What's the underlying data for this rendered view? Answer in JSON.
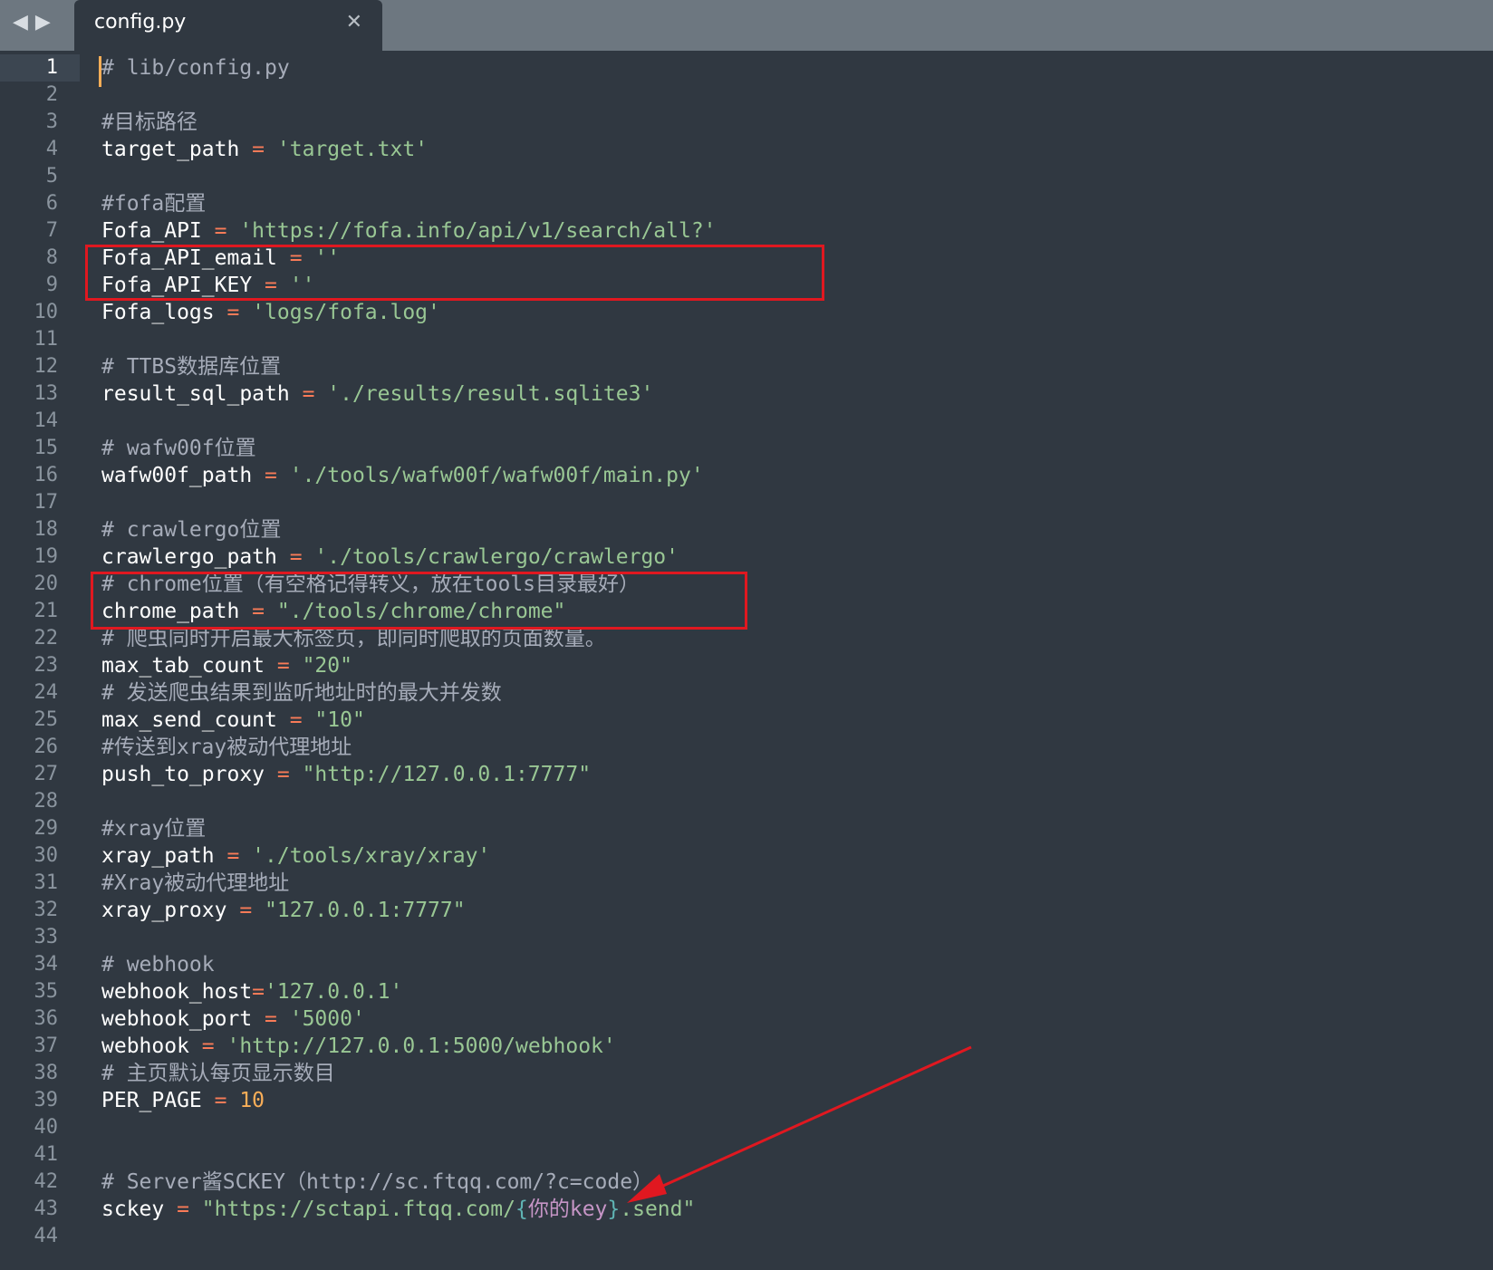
{
  "tab": {
    "title": "config.py"
  },
  "colors": {
    "background": "#303841",
    "tab_bar": "#6d7780",
    "highlight": "#e01820",
    "string": "#99c794",
    "operator": "#f97b58",
    "number": "#f9ae58",
    "comment": "#a6acb9"
  },
  "icons": {
    "back": "triangle-left-icon",
    "forward": "triangle-right-icon",
    "close": "close-icon"
  },
  "lines": [
    {
      "n": "1",
      "t": [
        [
          "cmt",
          "# lib/config.py"
        ]
      ]
    },
    {
      "n": "2",
      "t": []
    },
    {
      "n": "3",
      "t": [
        [
          "cmt",
          "#目标路径"
        ]
      ]
    },
    {
      "n": "4",
      "t": [
        [
          "var",
          "target_path"
        ],
        [
          "op",
          " = "
        ],
        [
          "str",
          "'target.txt'"
        ]
      ]
    },
    {
      "n": "5",
      "t": []
    },
    {
      "n": "6",
      "t": [
        [
          "cmt",
          "#fofa配置"
        ]
      ]
    },
    {
      "n": "7",
      "t": [
        [
          "var",
          "Fofa_API"
        ],
        [
          "op",
          " = "
        ],
        [
          "str",
          "'https://fofa.info/api/v1/search/all?'"
        ]
      ]
    },
    {
      "n": "8",
      "t": [
        [
          "var",
          "Fofa_API_email"
        ],
        [
          "op",
          " = "
        ],
        [
          "str",
          "''"
        ]
      ]
    },
    {
      "n": "9",
      "t": [
        [
          "var",
          "Fofa_API_KEY"
        ],
        [
          "op",
          " = "
        ],
        [
          "str",
          "''"
        ]
      ]
    },
    {
      "n": "10",
      "t": [
        [
          "var",
          "Fofa_logs"
        ],
        [
          "op",
          " = "
        ],
        [
          "str",
          "'logs/fofa.log'"
        ]
      ]
    },
    {
      "n": "11",
      "t": []
    },
    {
      "n": "12",
      "t": [
        [
          "cmt",
          "# TTBS数据库位置"
        ]
      ]
    },
    {
      "n": "13",
      "t": [
        [
          "var",
          "result_sql_path"
        ],
        [
          "op",
          " = "
        ],
        [
          "str",
          "'./results/result.sqlite3'"
        ]
      ]
    },
    {
      "n": "14",
      "t": []
    },
    {
      "n": "15",
      "t": [
        [
          "cmt",
          "# wafw00f位置"
        ]
      ]
    },
    {
      "n": "16",
      "t": [
        [
          "var",
          "wafw00f_path"
        ],
        [
          "op",
          " = "
        ],
        [
          "str",
          "'./tools/wafw00f/wafw00f/main.py'"
        ]
      ]
    },
    {
      "n": "17",
      "t": []
    },
    {
      "n": "18",
      "t": [
        [
          "cmt",
          "# crawlergo位置"
        ]
      ]
    },
    {
      "n": "19",
      "t": [
        [
          "var",
          "crawlergo_path"
        ],
        [
          "op",
          " = "
        ],
        [
          "str",
          "'./tools/crawlergo/crawlergo'"
        ]
      ]
    },
    {
      "n": "20",
      "t": [
        [
          "cmt",
          "# chrome位置（有空格记得转义，放在tools目录最好）"
        ]
      ]
    },
    {
      "n": "21",
      "t": [
        [
          "var",
          "chrome_path"
        ],
        [
          "op",
          " = "
        ],
        [
          "str",
          "\"./tools/chrome/chrome\""
        ]
      ]
    },
    {
      "n": "22",
      "t": [
        [
          "cmt",
          "# 爬虫同时开启最大标签页，即同时爬取的页面数量。"
        ]
      ]
    },
    {
      "n": "23",
      "t": [
        [
          "var",
          "max_tab_count"
        ],
        [
          "op",
          " = "
        ],
        [
          "str",
          "\"20\""
        ]
      ]
    },
    {
      "n": "24",
      "t": [
        [
          "cmt",
          "# 发送爬虫结果到监听地址时的最大并发数"
        ]
      ]
    },
    {
      "n": "25",
      "t": [
        [
          "var",
          "max_send_count"
        ],
        [
          "op",
          " = "
        ],
        [
          "str",
          "\"10\""
        ]
      ]
    },
    {
      "n": "26",
      "t": [
        [
          "cmt",
          "#传送到xray被动代理地址"
        ]
      ]
    },
    {
      "n": "27",
      "t": [
        [
          "var",
          "push_to_proxy"
        ],
        [
          "op",
          " = "
        ],
        [
          "str",
          "\"http://127.0.0.1:7777\""
        ]
      ]
    },
    {
      "n": "28",
      "t": []
    },
    {
      "n": "29",
      "t": [
        [
          "cmt",
          "#xray位置"
        ]
      ]
    },
    {
      "n": "30",
      "t": [
        [
          "var",
          "xray_path"
        ],
        [
          "op",
          " = "
        ],
        [
          "str",
          "'./tools/xray/xray'"
        ]
      ]
    },
    {
      "n": "31",
      "t": [
        [
          "cmt",
          "#Xray被动代理地址"
        ]
      ]
    },
    {
      "n": "32",
      "t": [
        [
          "var",
          "xray_proxy"
        ],
        [
          "op",
          " = "
        ],
        [
          "str",
          "\"127.0.0.1:7777\""
        ]
      ]
    },
    {
      "n": "33",
      "t": []
    },
    {
      "n": "34",
      "t": [
        [
          "cmt",
          "# webhook"
        ]
      ]
    },
    {
      "n": "35",
      "t": [
        [
          "var",
          "webhook_host"
        ],
        [
          "op",
          "="
        ],
        [
          "str",
          "'127.0.0.1'"
        ]
      ]
    },
    {
      "n": "36",
      "t": [
        [
          "var",
          "webhook_port"
        ],
        [
          "op",
          " = "
        ],
        [
          "str",
          "'5000'"
        ]
      ]
    },
    {
      "n": "37",
      "t": [
        [
          "var",
          "webhook"
        ],
        [
          "op",
          " = "
        ],
        [
          "str",
          "'http://127.0.0.1:5000/webhook'"
        ]
      ]
    },
    {
      "n": "38",
      "t": [
        [
          "cmt",
          "# 主页默认每页显示数目"
        ]
      ]
    },
    {
      "n": "39",
      "t": [
        [
          "var",
          "PER_PAGE"
        ],
        [
          "op",
          " = "
        ],
        [
          "num-lit",
          "10"
        ]
      ]
    },
    {
      "n": "40",
      "t": []
    },
    {
      "n": "41",
      "t": []
    },
    {
      "n": "42",
      "t": [
        [
          "cmt",
          "# Server酱SCKEY（http://sc.ftqq.com/?c=code）"
        ]
      ]
    },
    {
      "n": "43",
      "t": [
        [
          "var",
          "sckey"
        ],
        [
          "op",
          " = "
        ],
        [
          "str",
          "\"https://sctapi.ftqq.com/"
        ],
        [
          "brace",
          "{"
        ],
        [
          "ph",
          "你的key"
        ],
        [
          "brace",
          "}"
        ],
        [
          "str",
          ".send\""
        ]
      ]
    },
    {
      "n": "44",
      "t": []
    }
  ]
}
